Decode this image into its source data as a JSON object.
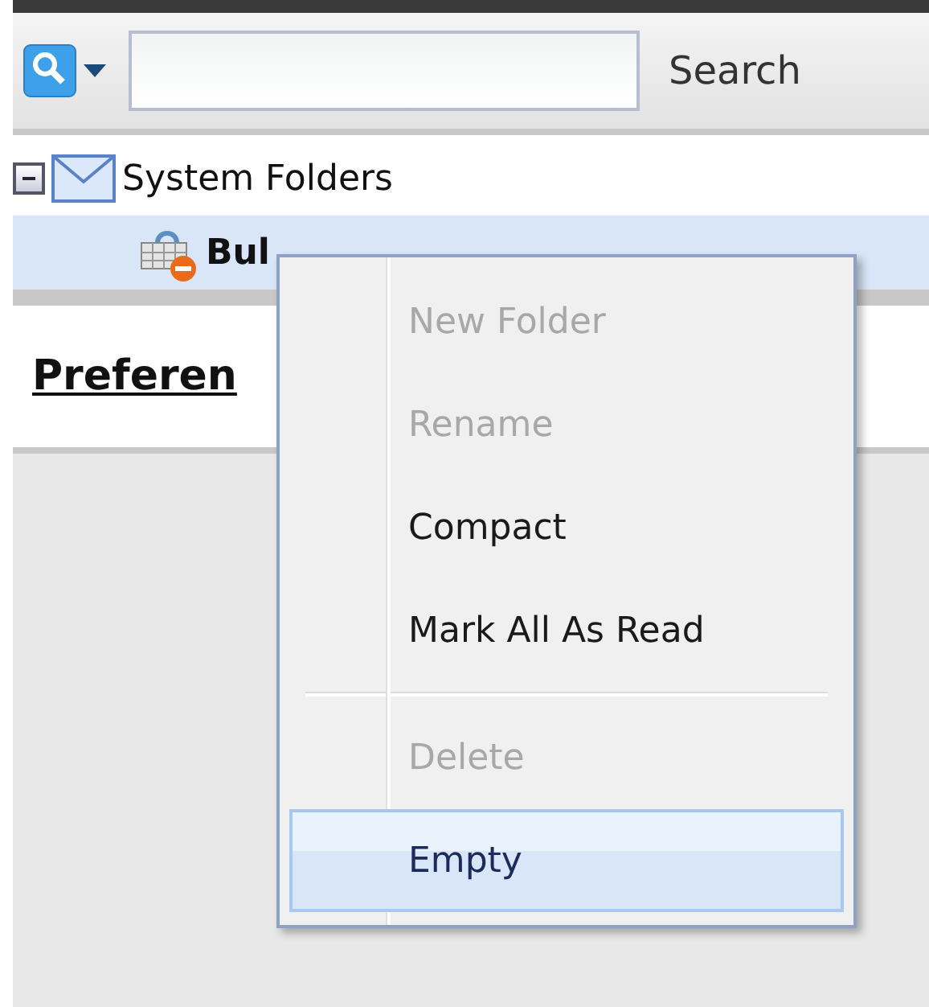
{
  "search": {
    "button": "Search"
  },
  "tree": [
    {
      "label": "System Folders",
      "expanded": true,
      "selected": false,
      "children": [
        {
          "label": "Bul",
          "selected": true
        }
      ]
    }
  ],
  "preferences_link": "Preferen",
  "context_menu": [
    {
      "label": "New Folder",
      "kind": "item",
      "disabled": true,
      "selected": false
    },
    {
      "label": "Rename",
      "kind": "item",
      "disabled": true,
      "selected": false
    },
    {
      "label": "Compact",
      "kind": "item",
      "disabled": false,
      "selected": false
    },
    {
      "label": "Mark All As Read",
      "kind": "item",
      "disabled": false,
      "selected": false
    },
    {
      "kind": "separator"
    },
    {
      "label": "Delete",
      "kind": "item",
      "disabled": true,
      "selected": false
    },
    {
      "label": "Empty",
      "kind": "item",
      "disabled": false,
      "selected": true
    }
  ]
}
